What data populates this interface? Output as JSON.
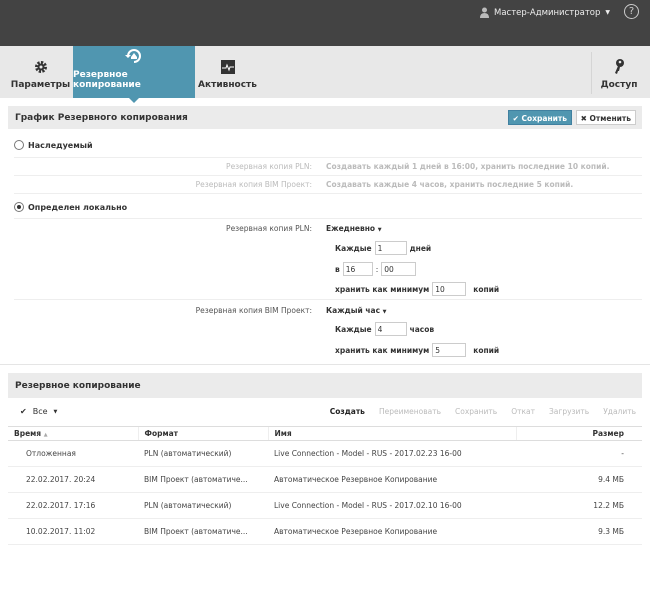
{
  "header": {
    "user": "Мастер-Администратор",
    "help": "?"
  },
  "tabs": [
    {
      "label": "Параметры",
      "icon": "gear-icon"
    },
    {
      "label": "Резервное копирование",
      "icon": "backup-icon",
      "active": true
    },
    {
      "label": "Активность",
      "icon": "activity-icon"
    },
    {
      "label": "Доступ",
      "icon": "key-icon"
    }
  ],
  "schedule": {
    "title": "График Резервного копирования",
    "save": "Сохранить",
    "cancel": "Отменить",
    "inherited": {
      "label": "Наследуемый",
      "pln_label": "Резервная копия PLN:",
      "pln_value": "Создавать каждый 1 дней в 16:00, хранить последние 10 копий.",
      "bim_label": "Резервная копия BIM Проект:",
      "bim_value": "Создавать каждые 4 часов, хранить последние 5 копий."
    },
    "local": {
      "label": "Определен локально",
      "pln_label": "Резервная копия PLN:",
      "pln_mode": "Ежедневно",
      "every": "Каждые",
      "days_value": "1",
      "days": "дней",
      "at": "в",
      "hour": "16",
      "colon": ":",
      "minute": "00",
      "keep": "хранить как минимум",
      "pln_keep": "10",
      "copies": "копий",
      "bim_label": "Резервная копия BIM Проект:",
      "bim_mode": "Каждый час",
      "hours_value": "4",
      "hours": "часов",
      "bim_keep": "5"
    }
  },
  "backups": {
    "title": "Резервное копирование",
    "select": "Все",
    "actions": [
      "Создать",
      "Переименовать",
      "Сохранить",
      "Откат",
      "Загрузить",
      "Удалить"
    ],
    "columns": [
      "Время",
      "Формат",
      "Имя",
      "Размер"
    ],
    "rows": [
      [
        "Отложенная",
        "PLN (автоматический)",
        "Live Connection - Model - RUS - 2017.02.23 16-00",
        "-"
      ],
      [
        "22.02.2017. 20:24",
        "BIM Проект (автоматиче...",
        "Автоматическое Резервное Копирование",
        "9.4 МБ"
      ],
      [
        "22.02.2017. 17:16",
        "PLN (автоматический)",
        "Live Connection - Model - RUS - 2017.02.10 16-00",
        "12.2 МБ"
      ],
      [
        "10.02.2017. 11:02",
        "BIM Проект (автоматиче...",
        "Автоматическое Резервное Копирование",
        "9.3 МБ"
      ]
    ]
  },
  "colors": {
    "accent": "#5096b0",
    "topbar": "#434343"
  }
}
